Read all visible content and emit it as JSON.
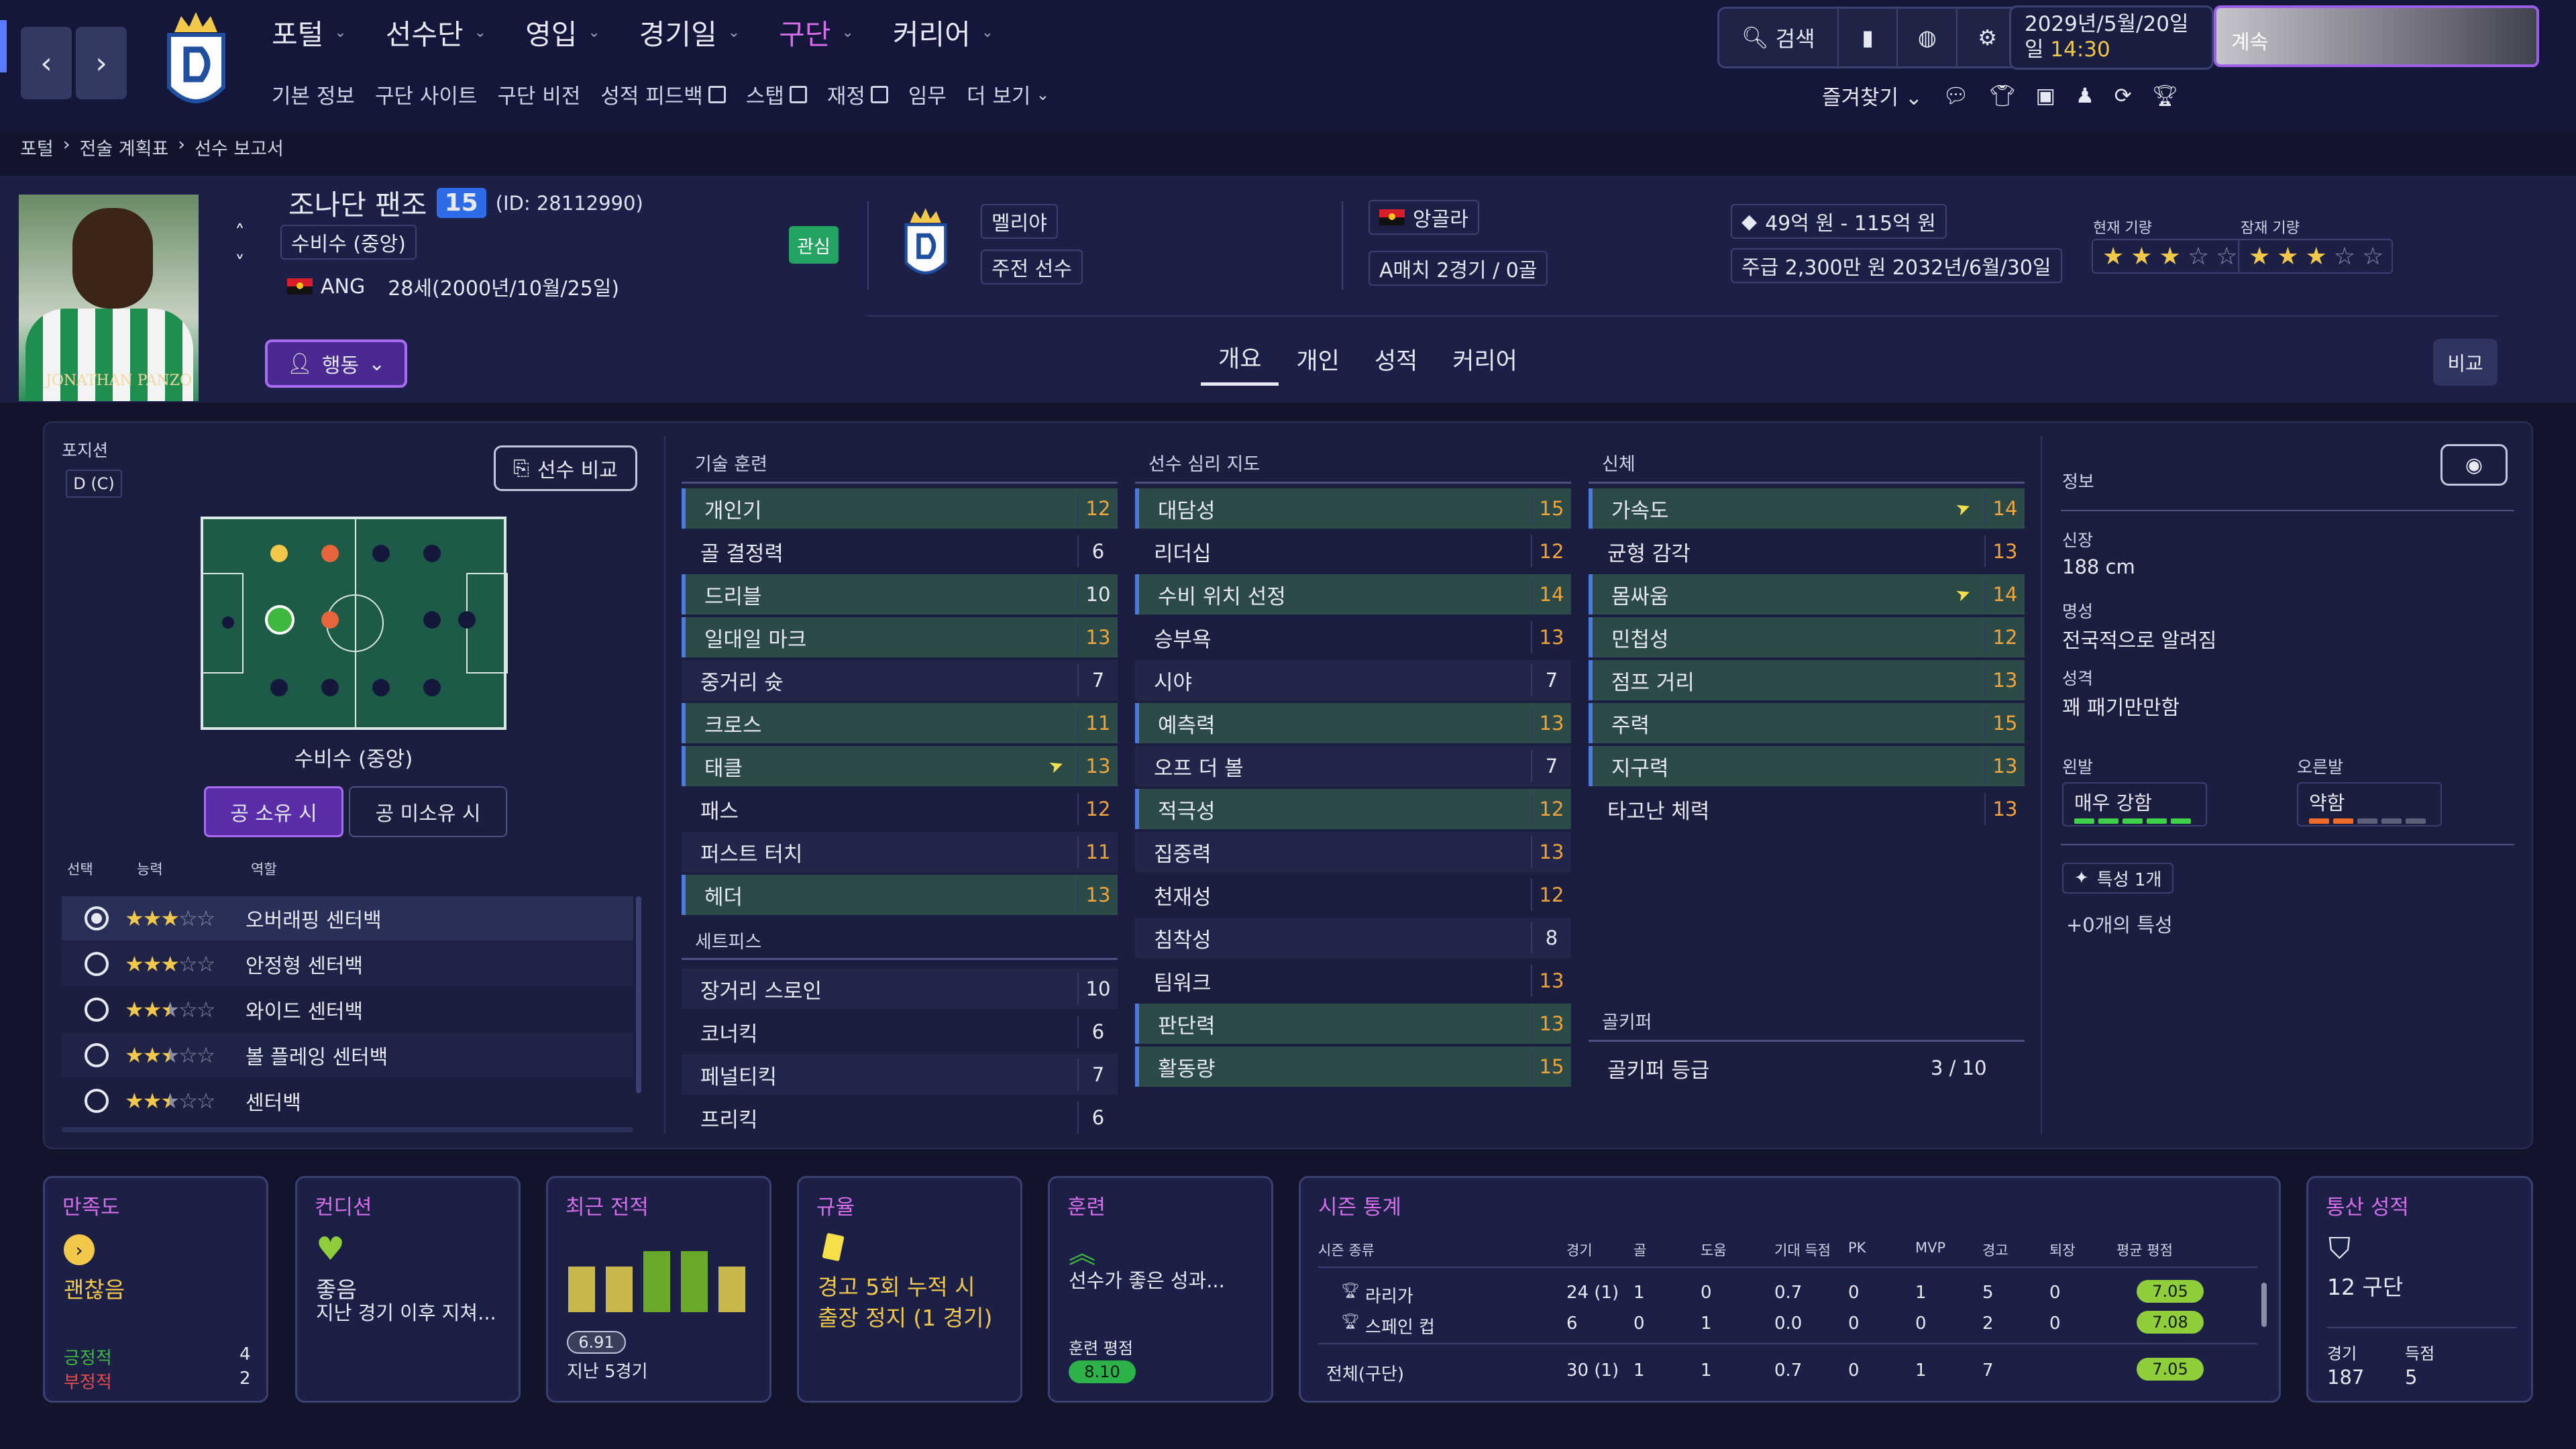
{
  "nav": {
    "main": [
      "포털",
      "선수단",
      "영입",
      "경기일",
      "구단",
      "커리어"
    ],
    "active": "구단",
    "sub": [
      "기본 정보",
      "구단 사이트",
      "구단 비전",
      "성적 피드백",
      "스탭",
      "재정",
      "임무",
      "더 보기"
    ],
    "search_label": "검색",
    "date": "2029년/5월/20일",
    "weekday": "일",
    "time": "14:30",
    "continue_label": "계속",
    "favorites_label": "즐겨찾기"
  },
  "breadcrumb": [
    "포털",
    "전술 계획표",
    "선수 보고서"
  ],
  "player": {
    "name": "조나단 팬조",
    "number": "15",
    "id_text": "(ID: 28112990)",
    "position": "수비수 (중앙)",
    "nation_code": "ANG",
    "age_text": "28세(2000년/10월/25일)",
    "interest_label": "관심",
    "club": "멜리야",
    "squad_status": "주전 선수",
    "nation": "앙골라",
    "caps": "A매치 2경기 / 0골",
    "value": "49억 원 - 115억 원",
    "wage": "주급 2,300만 원 2032년/6월/30일",
    "current_ability_label": "현재 기량",
    "potential_ability_label": "잠재 기량",
    "current_ability_stars": 3,
    "potential_ability_stars": 3,
    "shirt_name": "JONATHAN PANZO"
  },
  "action_label": "행동",
  "tabs": [
    "개요",
    "개인",
    "성적",
    "커리어"
  ],
  "active_tab": "개요",
  "compare_label": "비교",
  "position_panel": {
    "label": "포지션",
    "code": "D (C)",
    "compare_button": "선수 비교",
    "pitch_caption": "수비수 (중앙)",
    "in_possession": "공 소유 시",
    "out_possession": "공 미소유 시",
    "col_select": "선택",
    "col_ability": "능력",
    "col_role": "역할",
    "roles": [
      {
        "name": "오버래핑 센터백",
        "stars": 3,
        "selected": true
      },
      {
        "name": "안정형 센터백",
        "stars": 3,
        "selected": false
      },
      {
        "name": "와이드 센터백",
        "stars": 2.5,
        "selected": false
      },
      {
        "name": "볼 플레잉 센터백",
        "stars": 2.5,
        "selected": false
      },
      {
        "name": "센터백",
        "stars": 2.5,
        "selected": false
      }
    ]
  },
  "technical": {
    "title": "기술 훈련",
    "attrs": [
      {
        "name": "개인기",
        "value": 12,
        "color": "orange",
        "hl": true
      },
      {
        "name": "골 결정력",
        "value": 6,
        "color": "white",
        "hl": false
      },
      {
        "name": "드리블",
        "value": 10,
        "color": "white",
        "hl": true
      },
      {
        "name": "일대일 마크",
        "value": 13,
        "color": "orange",
        "hl": true
      },
      {
        "name": "중거리 슛",
        "value": 7,
        "color": "white",
        "hl": false
      },
      {
        "name": "크로스",
        "value": 11,
        "color": "orange",
        "hl": true
      },
      {
        "name": "태클",
        "value": 13,
        "color": "orange",
        "hl": true,
        "arrow": true
      },
      {
        "name": "패스",
        "value": 12,
        "color": "orange",
        "hl": false
      },
      {
        "name": "퍼스트 터치",
        "value": 11,
        "color": "orange",
        "hl": false
      },
      {
        "name": "헤더",
        "value": 13,
        "color": "orange",
        "hl": true
      }
    ],
    "setpiece_title": "세트피스",
    "setpieces": [
      {
        "name": "장거리 스로인",
        "value": 10,
        "color": "white"
      },
      {
        "name": "코너킥",
        "value": 6,
        "color": "white"
      },
      {
        "name": "페널티킥",
        "value": 7,
        "color": "white"
      },
      {
        "name": "프리킥",
        "value": 6,
        "color": "white"
      }
    ]
  },
  "mental": {
    "title": "선수 심리 지도",
    "attrs": [
      {
        "name": "대담성",
        "value": 15,
        "color": "orange",
        "hl": true
      },
      {
        "name": "리더십",
        "value": 12,
        "color": "orange",
        "hl": false
      },
      {
        "name": "수비 위치 선정",
        "value": 14,
        "color": "orange",
        "hl": true
      },
      {
        "name": "승부욕",
        "value": 13,
        "color": "orange",
        "hl": false
      },
      {
        "name": "시야",
        "value": 7,
        "color": "white",
        "hl": false
      },
      {
        "name": "예측력",
        "value": 13,
        "color": "orange",
        "hl": true
      },
      {
        "name": "오프 더 볼",
        "value": 7,
        "color": "white",
        "hl": false
      },
      {
        "name": "적극성",
        "value": 12,
        "color": "orange",
        "hl": true
      },
      {
        "name": "집중력",
        "value": 13,
        "color": "orange",
        "hl": false
      },
      {
        "name": "천재성",
        "value": 12,
        "color": "orange",
        "hl": false
      },
      {
        "name": "침착성",
        "value": 8,
        "color": "white",
        "hl": false
      },
      {
        "name": "팀워크",
        "value": 13,
        "color": "orange",
        "hl": false
      },
      {
        "name": "판단력",
        "value": 13,
        "color": "orange",
        "hl": true
      },
      {
        "name": "활동량",
        "value": 15,
        "color": "orange",
        "hl": true
      }
    ]
  },
  "physical": {
    "title": "신체",
    "attrs": [
      {
        "name": "가속도",
        "value": 14,
        "color": "orange",
        "hl": true,
        "arrow": true
      },
      {
        "name": "균형 감각",
        "value": 13,
        "color": "orange",
        "hl": false
      },
      {
        "name": "몸싸움",
        "value": 14,
        "color": "orange",
        "hl": true,
        "arrow": true
      },
      {
        "name": "민첩성",
        "value": 12,
        "color": "orange",
        "hl": true
      },
      {
        "name": "점프 거리",
        "value": 13,
        "color": "orange",
        "hl": true
      },
      {
        "name": "주력",
        "value": 15,
        "color": "orange",
        "hl": true
      },
      {
        "name": "지구력",
        "value": 13,
        "color": "orange",
        "hl": true
      },
      {
        "name": "타고난 체력",
        "value": 13,
        "color": "orange",
        "hl": false
      }
    ],
    "gk_title": "골키퍼",
    "gk_label": "골키퍼 등급",
    "gk_value": "3 / 10"
  },
  "info": {
    "title": "정보",
    "height_label": "신장",
    "height": "188 cm",
    "fame_label": "명성",
    "fame": "전국적으로 알려짐",
    "personality_label": "성격",
    "personality": "꽤 패기만만함",
    "left_foot_label": "왼발",
    "left_foot": "매우 강함",
    "left_foot_level": 5,
    "right_foot_label": "오른발",
    "right_foot": "약함",
    "right_foot_level": 2,
    "traits_button": "특성 1개",
    "traits_text": "+0개의 특성"
  },
  "cards": {
    "happiness": {
      "title": "만족도",
      "status": "괜찮음",
      "pos_label": "긍정적",
      "pos": "4",
      "neg_label": "부정적",
      "neg": "2"
    },
    "condition": {
      "title": "컨디션",
      "status": "좋음",
      "detail": "지난 경기 이후 지쳐..."
    },
    "form": {
      "title": "최근 전적",
      "rating": "6.91",
      "caption": "지난 5경기",
      "bars": [
        0.6,
        0.6,
        0.8,
        0.8,
        0.6
      ]
    },
    "discipline": {
      "title": "규율",
      "text1": "경고 5회 누적 시",
      "text2": "출장 정지 (1 경기)"
    },
    "training": {
      "title": "훈련",
      "text": "선수가 좋은 성과...",
      "rating_label": "훈련 평점",
      "rating": "8.10"
    },
    "season": {
      "title": "시즌 통계",
      "headers": [
        "시즌 종류",
        "경기",
        "골",
        "도움",
        "기대 득점",
        "PK",
        "MVP",
        "경고",
        "퇴장",
        "평균 평점"
      ],
      "rows": [
        {
          "name": "라리가",
          "cells": [
            "24 (1)",
            "1",
            "0",
            "0.7",
            "0",
            "1",
            "5",
            "0"
          ],
          "rating": "7.05"
        },
        {
          "name": "스페인 컵",
          "cells": [
            "6",
            "0",
            "1",
            "0.0",
            "0",
            "0",
            "2",
            "0"
          ],
          "rating": "7.08"
        }
      ],
      "total": {
        "name": "전체(구단)",
        "cells": [
          "30 (1)",
          "1",
          "1",
          "0.7",
          "0",
          "1",
          "7",
          ""
        ],
        "rating": "7.05"
      }
    },
    "career": {
      "title": "통산 성적",
      "clubs": "12 구단",
      "apps_label": "경기",
      "apps": "187",
      "goals_label": "득점",
      "goals": "5"
    }
  },
  "colors": {
    "accent": "#d36ee8",
    "orange": "#f0a43a",
    "green": "#23a462",
    "rating": "#8fce3a"
  }
}
